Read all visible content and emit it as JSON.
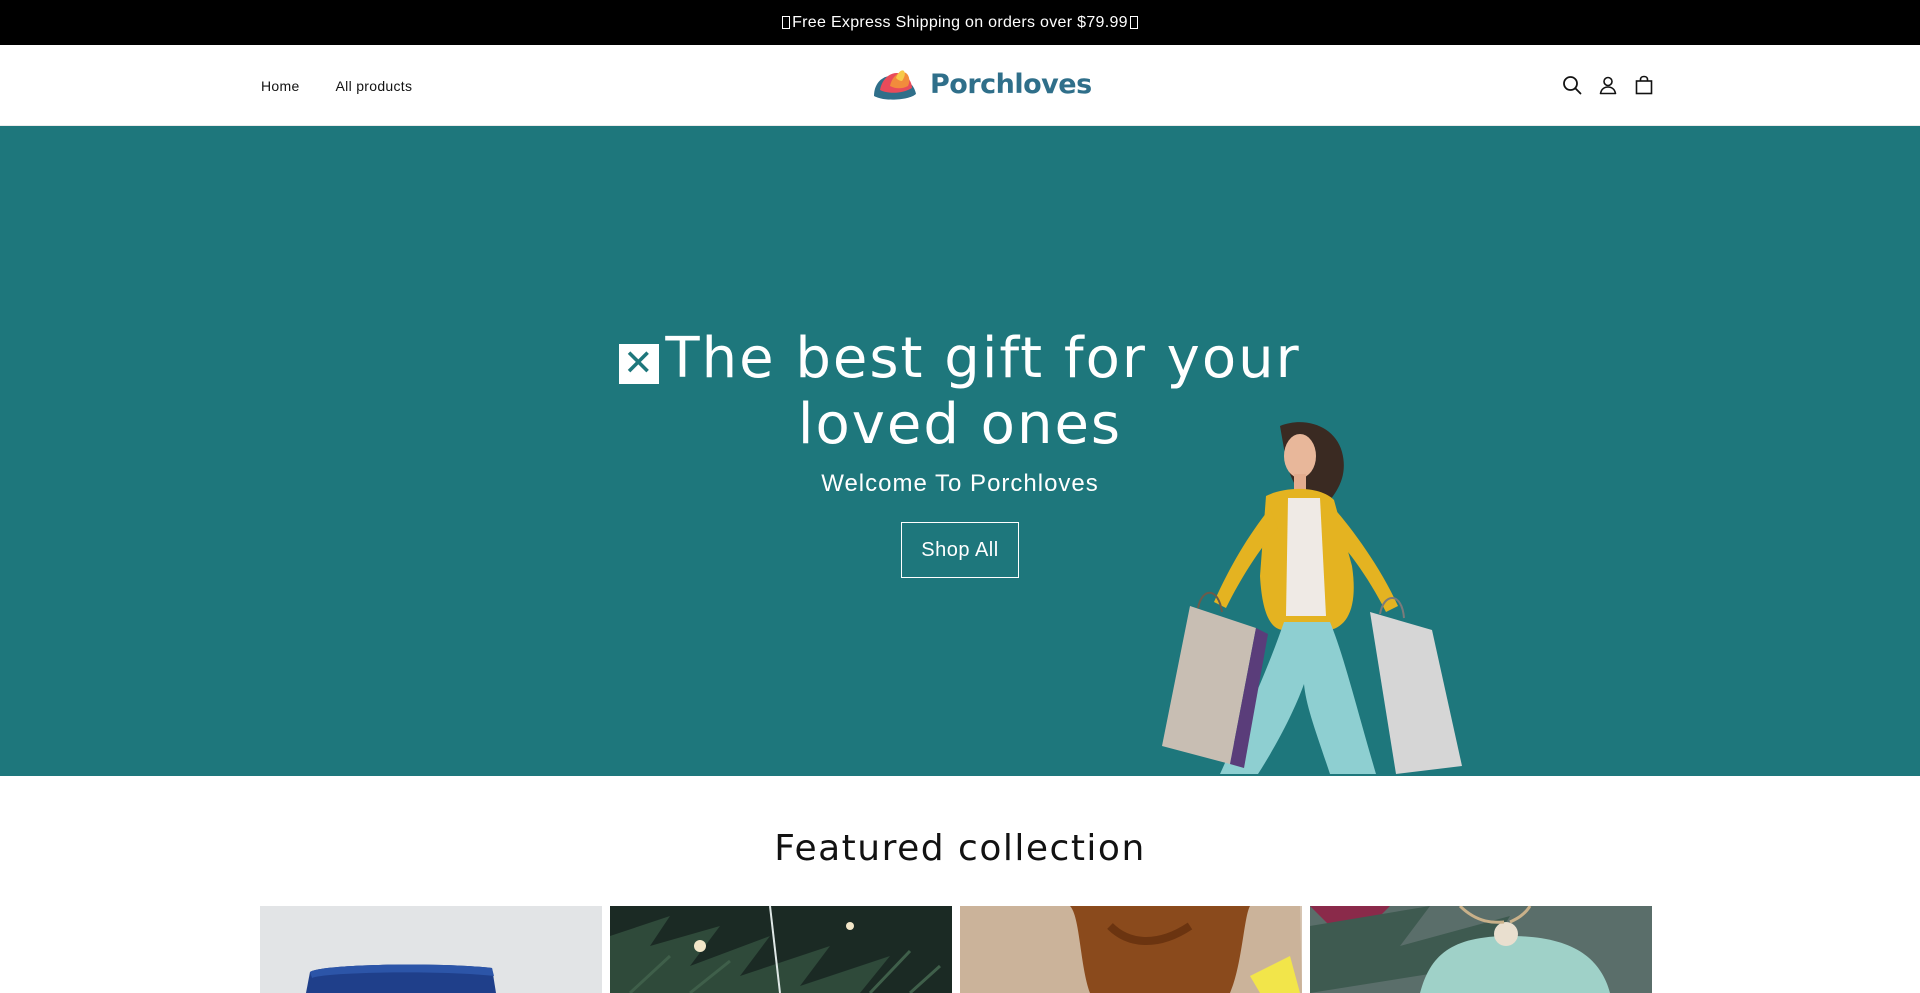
{
  "announcement": {
    "text": "Free Express Shipping on orders over $79.99"
  },
  "header": {
    "nav": [
      {
        "label": "Home"
      },
      {
        "label": "All products"
      }
    ],
    "logo_text": "Porchloves",
    "icons": [
      "search-icon",
      "account-icon",
      "cart-icon"
    ]
  },
  "hero": {
    "title": "The best gift for your loved ones",
    "subtitle": "Welcome To Porchloves",
    "button_label": "Shop All",
    "background_color": "#1e777c"
  },
  "featured": {
    "title": "Featured collection",
    "products": [
      {
        "image": "blue-gift-box"
      },
      {
        "image": "christmas-tree-ornament"
      },
      {
        "image": "ceramic-mug"
      },
      {
        "image": "glass-ornament"
      }
    ]
  },
  "colors": {
    "accent": "#1e777c",
    "announcement_bg": "#000000",
    "logo_text": "#2f6f8a"
  }
}
